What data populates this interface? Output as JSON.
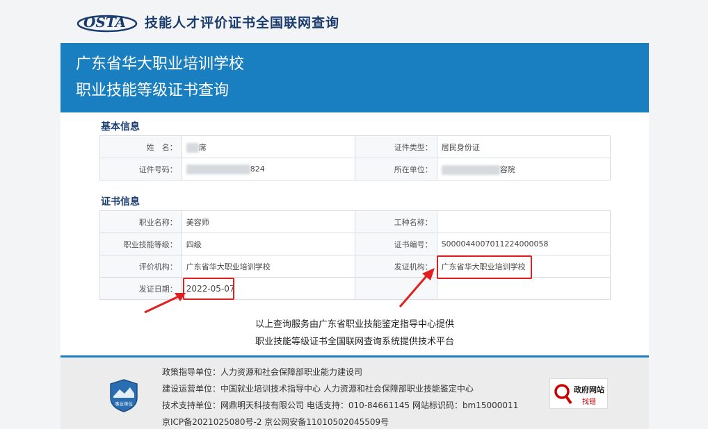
{
  "header": {
    "logo_text": "OSTA",
    "site_title": "技能人才评价证书全国联网查询"
  },
  "banner": {
    "line1": "广东省华大职业培训学校",
    "line2": "职业技能等级证书查询"
  },
  "basic_info": {
    "title": "基本信息",
    "rows": [
      {
        "label1": "姓　名：",
        "value1": "席",
        "label2": "证件类型：",
        "value2": "居民身份证"
      },
      {
        "label1": "证件号码：",
        "value1": "824",
        "label2": "所在单位：",
        "value2": "容院"
      }
    ]
  },
  "cert_info": {
    "title": "证书信息",
    "rows": [
      {
        "label1": "职业名称：",
        "value1": "美容师",
        "label2": "工种名称：",
        "value2": ""
      },
      {
        "label1": "职业技能等级：",
        "value1": "四级",
        "label2": "证书编号：",
        "value2": "S000044007011224000058"
      },
      {
        "label1": "评价机构：",
        "value1": "广东省华大职业培训学校",
        "label2": "发证机构：",
        "value2": "广东省华大职业培训学校"
      },
      {
        "label1": "发证日期：",
        "value1": "2022-05-07",
        "label2": "",
        "value2": ""
      }
    ]
  },
  "notice": {
    "line1": "以上查询服务由广东省职业技能鉴定指导中心提供",
    "line2": "职业技能等级证书全国联网查询系统提供技术平台"
  },
  "footer": {
    "emblem_text": "事业单位",
    "line1": "政策指导单位：人力资源和社会保障部职业能力建设司",
    "line2": "建设运营单位：中国就业培训技术指导中心  人力资源和社会保障部职业技能鉴定中心",
    "line3": "技术支持单位：网鼎明天科技有限公司   电话支持：010-84661145   网站标识码：bm15000011",
    "line4": "京ICP备2021025080号-2    京公网安备11010502045509号",
    "gov_badge_title": "政府网站",
    "gov_badge_sub": "找错"
  },
  "colors": {
    "brand_blue": "#1a7fc0",
    "title_navy": "#1a3b6e",
    "highlight_red": "#e02020"
  }
}
